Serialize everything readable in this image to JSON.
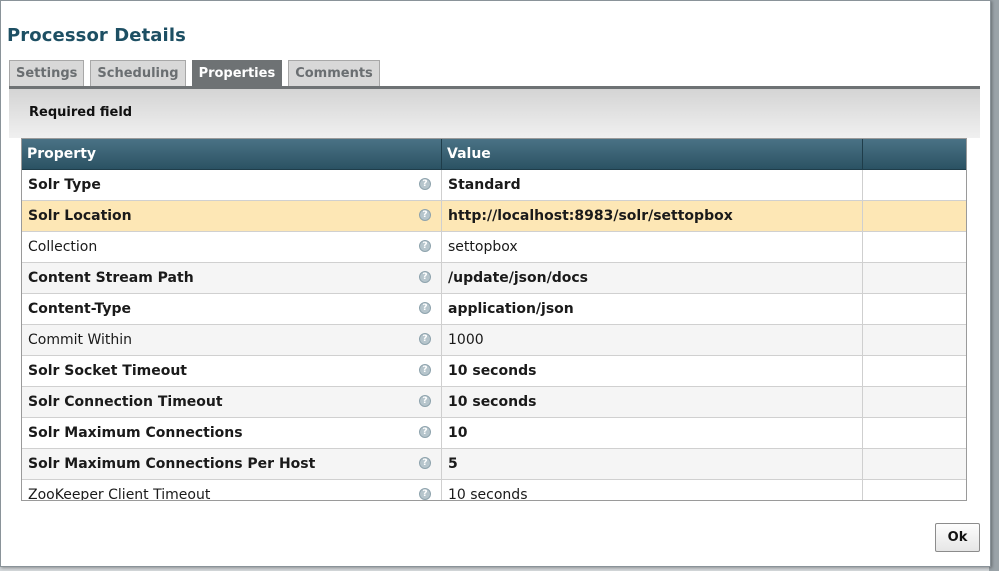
{
  "dialog": {
    "title": "Processor Details",
    "ok_label": "Ok"
  },
  "tabs": [
    {
      "label": "Settings",
      "active": false
    },
    {
      "label": "Scheduling",
      "active": false
    },
    {
      "label": "Properties",
      "active": true
    },
    {
      "label": "Comments",
      "active": false
    }
  ],
  "properties": {
    "required_label": "Required field",
    "columns": {
      "property": "Property",
      "value": "Value"
    },
    "help_glyph": "?",
    "rows": [
      {
        "name": "Solr Type",
        "value": "Standard",
        "required": true,
        "selected": false
      },
      {
        "name": "Solr Location",
        "value": "http://localhost:8983/solr/settopbox",
        "required": true,
        "selected": true
      },
      {
        "name": "Collection",
        "value": "settopbox",
        "required": false,
        "selected": false
      },
      {
        "name": "Content Stream Path",
        "value": "/update/json/docs",
        "required": true,
        "selected": false
      },
      {
        "name": "Content-Type",
        "value": "application/json",
        "required": true,
        "selected": false
      },
      {
        "name": "Commit Within",
        "value": "1000",
        "required": false,
        "selected": false
      },
      {
        "name": "Solr Socket Timeout",
        "value": "10 seconds",
        "required": true,
        "selected": false
      },
      {
        "name": "Solr Connection Timeout",
        "value": "10 seconds",
        "required": true,
        "selected": false
      },
      {
        "name": "Solr Maximum Connections",
        "value": "10",
        "required": true,
        "selected": false
      },
      {
        "name": "Solr Maximum Connections Per Host",
        "value": "5",
        "required": true,
        "selected": false
      },
      {
        "name": "ZooKeeper Client Timeout",
        "value": "10 seconds",
        "required": false,
        "selected": false
      }
    ]
  },
  "colors": {
    "title": "#1d4f63",
    "header_bg": "#2b5263",
    "selected_row": "#fde7b5",
    "active_tab": "#6e7274"
  }
}
